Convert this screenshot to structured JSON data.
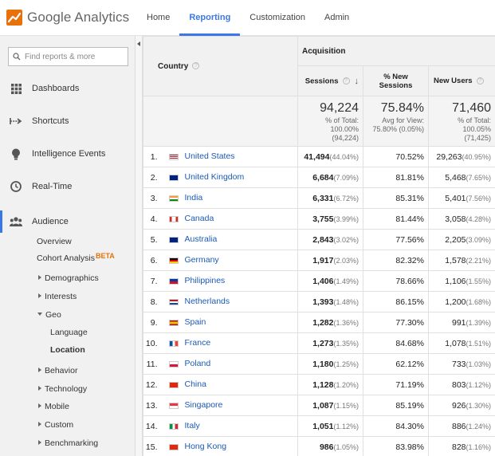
{
  "header": {
    "logo_text": "Google Analytics",
    "nav": [
      {
        "label": "Home",
        "active": false
      },
      {
        "label": "Reporting",
        "active": true
      },
      {
        "label": "Customization",
        "active": false
      },
      {
        "label": "Admin",
        "active": false
      }
    ]
  },
  "sidebar": {
    "search_placeholder": "Find reports & more",
    "items": [
      {
        "label": "Dashboards",
        "icon": "grid-icon"
      },
      {
        "label": "Shortcuts",
        "icon": "shortcut-arrow-icon"
      },
      {
        "label": "Intelligence Events",
        "icon": "lightbulb-icon"
      },
      {
        "label": "Real-Time",
        "icon": "clock-icon"
      },
      {
        "label": "Audience",
        "icon": "people-icon"
      }
    ],
    "audience_sub": {
      "overview": "Overview",
      "cohort": "Cohort Analysis",
      "cohort_badge": "BETA",
      "demographics": "Demographics",
      "interests": "Interests",
      "geo": "Geo",
      "language": "Language",
      "location": "Location",
      "behavior": "Behavior",
      "technology": "Technology",
      "mobile": "Mobile",
      "custom": "Custom",
      "benchmarking": "Benchmarking"
    }
  },
  "table": {
    "col_country": "Country",
    "col_group": "Acquisition",
    "col_sessions": "Sessions",
    "col_new_sessions": "% New Sessions",
    "col_new_users": "New Users",
    "totals": {
      "sessions": "94,224",
      "sessions_note1": "% of Total:",
      "sessions_note2": "100.00%",
      "sessions_note3": "(94,224)",
      "new_sessions": "75.84%",
      "new_sessions_note1": "Avg for View:",
      "new_sessions_note2": "75.80% (0.05%)",
      "new_users": "71,460",
      "new_users_note1": "% of Total:",
      "new_users_note2": "100.05%",
      "new_users_note3": "(71,425)"
    },
    "rows": [
      {
        "idx": "1.",
        "country": "United States",
        "sessions": "41,494",
        "sessions_pct": "(44.04%)",
        "new_sessions": "70.52%",
        "new_users": "29,263",
        "new_users_pct": "(40.95%)"
      },
      {
        "idx": "2.",
        "country": "United Kingdom",
        "sessions": "6,684",
        "sessions_pct": "(7.09%)",
        "new_sessions": "81.81%",
        "new_users": "5,468",
        "new_users_pct": "(7.65%)"
      },
      {
        "idx": "3.",
        "country": "India",
        "sessions": "6,331",
        "sessions_pct": "(6.72%)",
        "new_sessions": "85.31%",
        "new_users": "5,401",
        "new_users_pct": "(7.56%)"
      },
      {
        "idx": "4.",
        "country": "Canada",
        "sessions": "3,755",
        "sessions_pct": "(3.99%)",
        "new_sessions": "81.44%",
        "new_users": "3,058",
        "new_users_pct": "(4.28%)"
      },
      {
        "idx": "5.",
        "country": "Australia",
        "sessions": "2,843",
        "sessions_pct": "(3.02%)",
        "new_sessions": "77.56%",
        "new_users": "2,205",
        "new_users_pct": "(3.09%)"
      },
      {
        "idx": "6.",
        "country": "Germany",
        "sessions": "1,917",
        "sessions_pct": "(2.03%)",
        "new_sessions": "82.32%",
        "new_users": "1,578",
        "new_users_pct": "(2.21%)"
      },
      {
        "idx": "7.",
        "country": "Philippines",
        "sessions": "1,406",
        "sessions_pct": "(1.49%)",
        "new_sessions": "78.66%",
        "new_users": "1,106",
        "new_users_pct": "(1.55%)"
      },
      {
        "idx": "8.",
        "country": "Netherlands",
        "sessions": "1,393",
        "sessions_pct": "(1.48%)",
        "new_sessions": "86.15%",
        "new_users": "1,200",
        "new_users_pct": "(1.68%)"
      },
      {
        "idx": "9.",
        "country": "Spain",
        "sessions": "1,282",
        "sessions_pct": "(1.36%)",
        "new_sessions": "77.30%",
        "new_users": "991",
        "new_users_pct": "(1.39%)"
      },
      {
        "idx": "10.",
        "country": "France",
        "sessions": "1,273",
        "sessions_pct": "(1.35%)",
        "new_sessions": "84.68%",
        "new_users": "1,078",
        "new_users_pct": "(1.51%)"
      },
      {
        "idx": "11.",
        "country": "Poland",
        "sessions": "1,180",
        "sessions_pct": "(1.25%)",
        "new_sessions": "62.12%",
        "new_users": "733",
        "new_users_pct": "(1.03%)"
      },
      {
        "idx": "12.",
        "country": "China",
        "sessions": "1,128",
        "sessions_pct": "(1.20%)",
        "new_sessions": "71.19%",
        "new_users": "803",
        "new_users_pct": "(1.12%)"
      },
      {
        "idx": "13.",
        "country": "Singapore",
        "sessions": "1,087",
        "sessions_pct": "(1.15%)",
        "new_sessions": "85.19%",
        "new_users": "926",
        "new_users_pct": "(1.30%)"
      },
      {
        "idx": "14.",
        "country": "Italy",
        "sessions": "1,051",
        "sessions_pct": "(1.12%)",
        "new_sessions": "84.30%",
        "new_users": "886",
        "new_users_pct": "(1.24%)"
      },
      {
        "idx": "15.",
        "country": "Hong Kong",
        "sessions": "986",
        "sessions_pct": "(1.05%)",
        "new_sessions": "83.98%",
        "new_users": "828",
        "new_users_pct": "(1.16%)"
      }
    ]
  }
}
